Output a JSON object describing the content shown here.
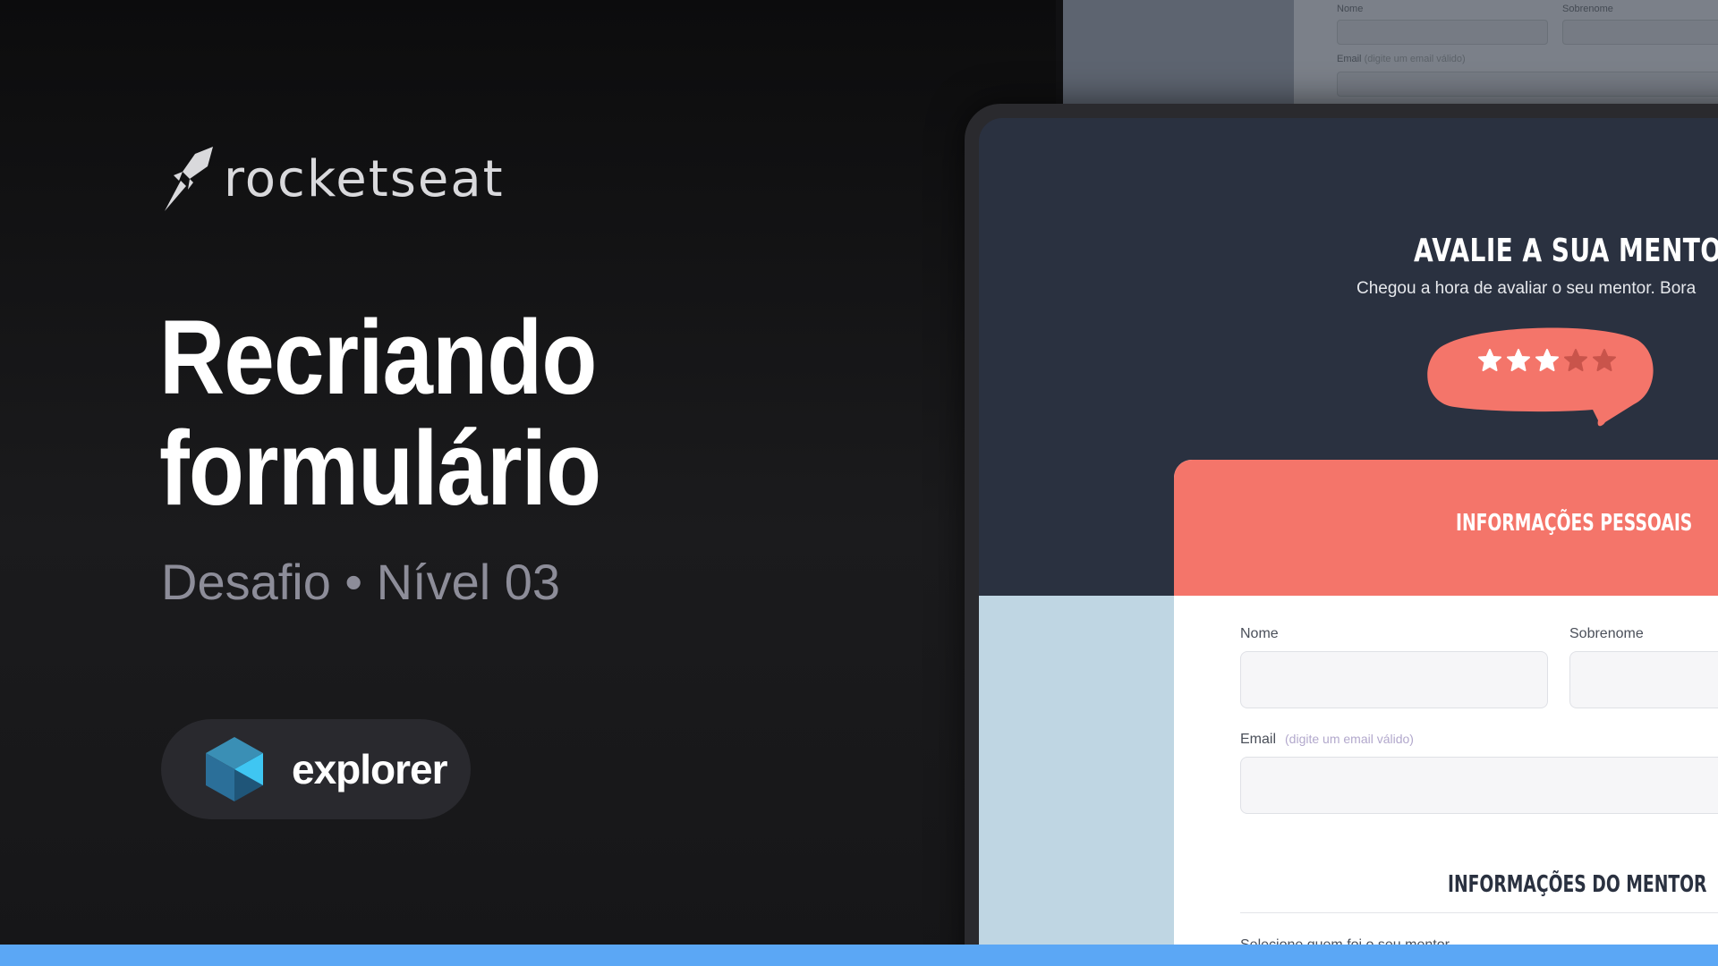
{
  "brand": {
    "name": "rocketseat",
    "icon": "rocket-icon"
  },
  "headline": {
    "line1": "Recriando",
    "line2": "formulário"
  },
  "subtitle": "Desafio • Nível 03",
  "badge": {
    "label": "explorer",
    "icon": "explorer-cube-icon"
  },
  "preview": {
    "title": "AVALIE A SUA MENTORIA",
    "subtitle": "Chegou a hora de avaliar o seu mentor. Bora",
    "rating": {
      "value": 3,
      "max": 5,
      "bubble_color": "#f4756a"
    },
    "form": {
      "section1_title": "INFORMAÇÕES PESSOAIS",
      "first_name_label": "Nome",
      "last_name_label": "Sobrenome",
      "email_label": "Email",
      "email_hint": "(digite um email válido)",
      "section2_title": "INFORMAÇÕES DO MENTOR",
      "select_label": "Selecione quem foi o seu mentor"
    },
    "ghost": {
      "first_name_label": "Nome",
      "last_name_label": "Sobrenome",
      "email_label": "Email",
      "email_hint": "(digite um email válido)"
    }
  },
  "colors": {
    "background": "#111113",
    "accent_coral": "#f4756a",
    "screen_dark": "#2a3140",
    "bottom_bar": "#5ba7f5",
    "subtitle_gray": "#8d8d99"
  }
}
